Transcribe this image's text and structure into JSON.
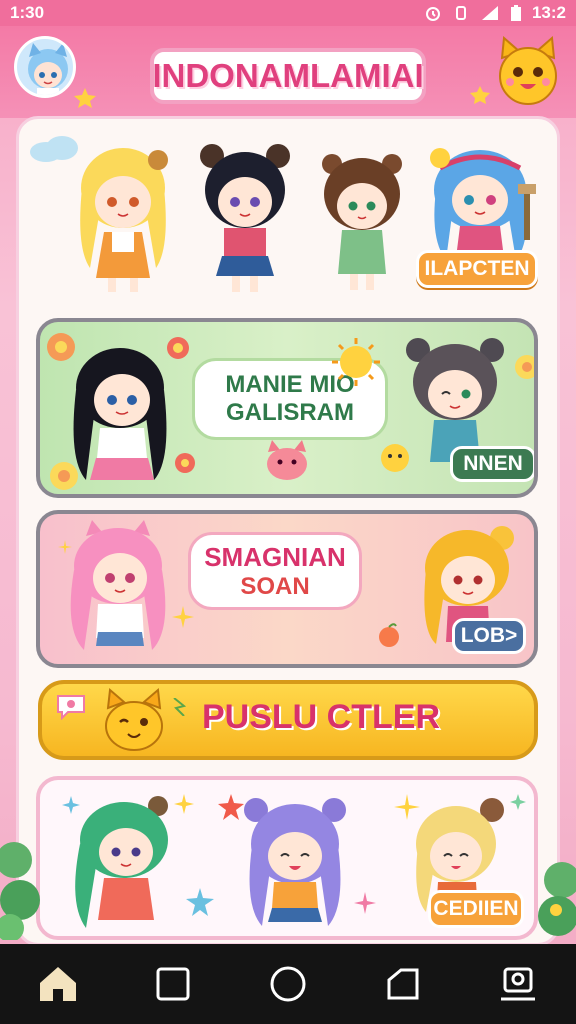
{
  "status_bar": {
    "time": "1:30",
    "clock_right": "13:2",
    "icons": [
      "alarm-icon",
      "vibrate-icon",
      "signal-icon",
      "battery-icon"
    ]
  },
  "header": {
    "title": "INDONAMLAMIAI",
    "avatar_icon": "girl-avatar-icon",
    "mascot_icon": "yellow-cat-icon"
  },
  "cards": {
    "top_row": {
      "tag": "ILAPCTEN",
      "characters": [
        "blonde-girl",
        "black-hair-bear-girl",
        "brown-hair-girl",
        "blue-hair-girl"
      ]
    },
    "green_card": {
      "line1": "MANIE MIO",
      "line2": "GALISRAM",
      "tag": "NNEN"
    },
    "pink_card": {
      "line1": "SMAGNIAN",
      "line2": "SOAN",
      "tag": "LOB>"
    },
    "yellow_button": {
      "label": "PUSLU CTLER"
    },
    "bottom_card": {
      "tag": "CEDIIEN"
    }
  },
  "navbar": {
    "items": [
      "home-icon",
      "square-icon",
      "circle-icon",
      "back-icon",
      "profile-icon"
    ]
  },
  "colors": {
    "accent": "#e0407e",
    "status_bar": "#f06e9c",
    "tag_orange": "#f7a23a",
    "tag_green": "#3c7a52",
    "tag_blue": "#4a6fa0",
    "yellow": "#f7b621"
  }
}
